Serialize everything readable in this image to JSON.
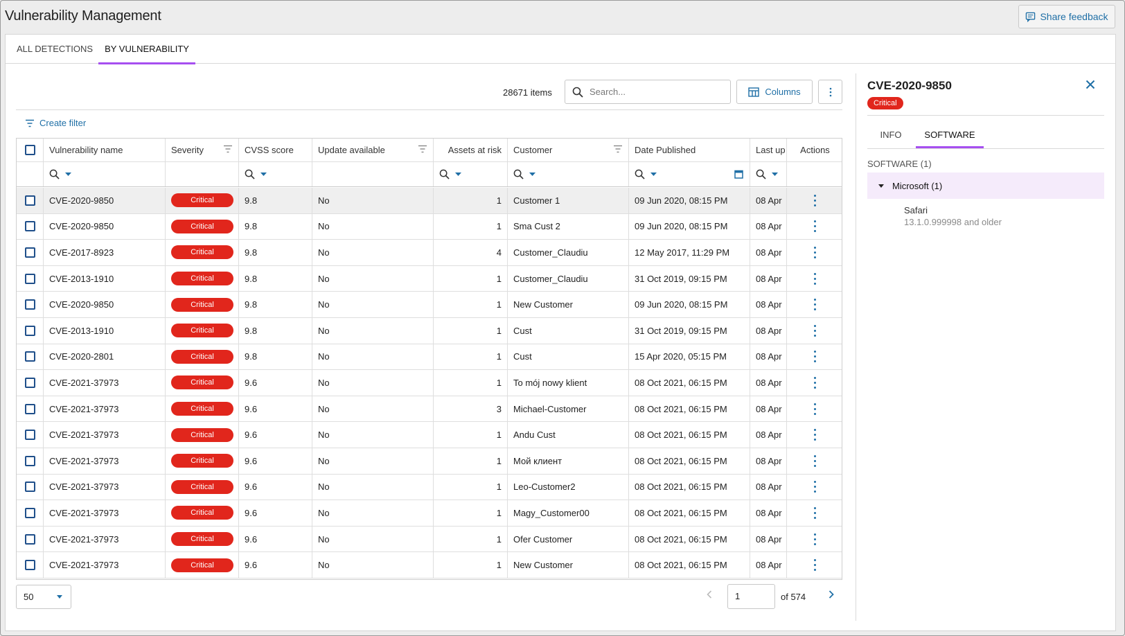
{
  "app": {
    "title": "Vulnerability Management",
    "feedback_label": "Share feedback"
  },
  "tabs": [
    {
      "label": "ALL DETECTIONS"
    },
    {
      "label": "BY VULNERABILITY"
    }
  ],
  "toolbar": {
    "items_count": "28671 items",
    "search_placeholder": "Search...",
    "columns_label": "Columns",
    "create_filter_label": "Create filter"
  },
  "table": {
    "columns": [
      "Vulnerability name",
      "Severity",
      "CVSS score",
      "Update available",
      "Assets at risk",
      "Customer",
      "Date Published",
      "Last up",
      "Actions"
    ],
    "rows": [
      {
        "name": "CVE-2020-9850",
        "severity": "Critical",
        "cvss": "9.8",
        "update": "No",
        "assets": "1",
        "customer": "Customer 1",
        "published": "09 Jun 2020, 08:15 PM",
        "last": "08 Apr"
      },
      {
        "name": "CVE-2020-9850",
        "severity": "Critical",
        "cvss": "9.8",
        "update": "No",
        "assets": "1",
        "customer": "Sma Cust 2",
        "published": "09 Jun 2020, 08:15 PM",
        "last": "08 Apr"
      },
      {
        "name": "CVE-2017-8923",
        "severity": "Critical",
        "cvss": "9.8",
        "update": "No",
        "assets": "4",
        "customer": "Customer_Claudiu",
        "published": "12 May 2017, 11:29 PM",
        "last": "08 Apr"
      },
      {
        "name": "CVE-2013-1910",
        "severity": "Critical",
        "cvss": "9.8",
        "update": "No",
        "assets": "1",
        "customer": "Customer_Claudiu",
        "published": "31 Oct 2019, 09:15 PM",
        "last": "08 Apr"
      },
      {
        "name": "CVE-2020-9850",
        "severity": "Critical",
        "cvss": "9.8",
        "update": "No",
        "assets": "1",
        "customer": "New Customer",
        "published": "09 Jun 2020, 08:15 PM",
        "last": "08 Apr"
      },
      {
        "name": "CVE-2013-1910",
        "severity": "Critical",
        "cvss": "9.8",
        "update": "No",
        "assets": "1",
        "customer": "Cust",
        "published": "31 Oct 2019, 09:15 PM",
        "last": "08 Apr"
      },
      {
        "name": "CVE-2020-2801",
        "severity": "Critical",
        "cvss": "9.8",
        "update": "No",
        "assets": "1",
        "customer": "Cust",
        "published": "15 Apr 2020, 05:15 PM",
        "last": "08 Apr"
      },
      {
        "name": "CVE-2021-37973",
        "severity": "Critical",
        "cvss": "9.6",
        "update": "No",
        "assets": "1",
        "customer": "To mój nowy klient",
        "published": "08 Oct 2021, 06:15 PM",
        "last": "08 Apr"
      },
      {
        "name": "CVE-2021-37973",
        "severity": "Critical",
        "cvss": "9.6",
        "update": "No",
        "assets": "3",
        "customer": "Michael-Customer",
        "published": "08 Oct 2021, 06:15 PM",
        "last": "08 Apr"
      },
      {
        "name": "CVE-2021-37973",
        "severity": "Critical",
        "cvss": "9.6",
        "update": "No",
        "assets": "1",
        "customer": "Andu Cust",
        "published": "08 Oct 2021, 06:15 PM",
        "last": "08 Apr"
      },
      {
        "name": "CVE-2021-37973",
        "severity": "Critical",
        "cvss": "9.6",
        "update": "No",
        "assets": "1",
        "customer": "Мой клиент",
        "published": "08 Oct 2021, 06:15 PM",
        "last": "08 Apr"
      },
      {
        "name": "CVE-2021-37973",
        "severity": "Critical",
        "cvss": "9.6",
        "update": "No",
        "assets": "1",
        "customer": "Leo-Customer2",
        "published": "08 Oct 2021, 06:15 PM",
        "last": "08 Apr"
      },
      {
        "name": "CVE-2021-37973",
        "severity": "Critical",
        "cvss": "9.6",
        "update": "No",
        "assets": "1",
        "customer": "Magy_Customer00",
        "published": "08 Oct 2021, 06:15 PM",
        "last": "08 Apr"
      },
      {
        "name": "CVE-2021-37973",
        "severity": "Critical",
        "cvss": "9.6",
        "update": "No",
        "assets": "1",
        "customer": "Ofer Customer",
        "published": "08 Oct 2021, 06:15 PM",
        "last": "08 Apr"
      },
      {
        "name": "CVE-2021-37973",
        "severity": "Critical",
        "cvss": "9.6",
        "update": "No",
        "assets": "1",
        "customer": "New Customer",
        "published": "08 Oct 2021, 06:15 PM",
        "last": "08 Apr"
      }
    ]
  },
  "pagination": {
    "page_size": "50",
    "current_page": "1",
    "of_label": "of 574"
  },
  "side_panel": {
    "title": "CVE-2020-9850",
    "severity": "Critical",
    "tabs": [
      "INFO",
      "SOFTWARE"
    ],
    "software_heading": "SOFTWARE (1)",
    "vendor": "Microsoft (1)",
    "software_name": "Safari",
    "software_version": "13.1.0.999998 and older"
  },
  "colors": {
    "accent_purple": "#a64ff0",
    "link_blue": "#1f6fa6",
    "critical_red": "#e1261c"
  },
  "icons": {
    "feedback": "feedback-icon",
    "search": "search-icon",
    "columns": "columns-icon",
    "more": "more-vertical-icon",
    "filter": "filter-icon",
    "close": "close-icon",
    "calendar": "calendar-icon"
  }
}
